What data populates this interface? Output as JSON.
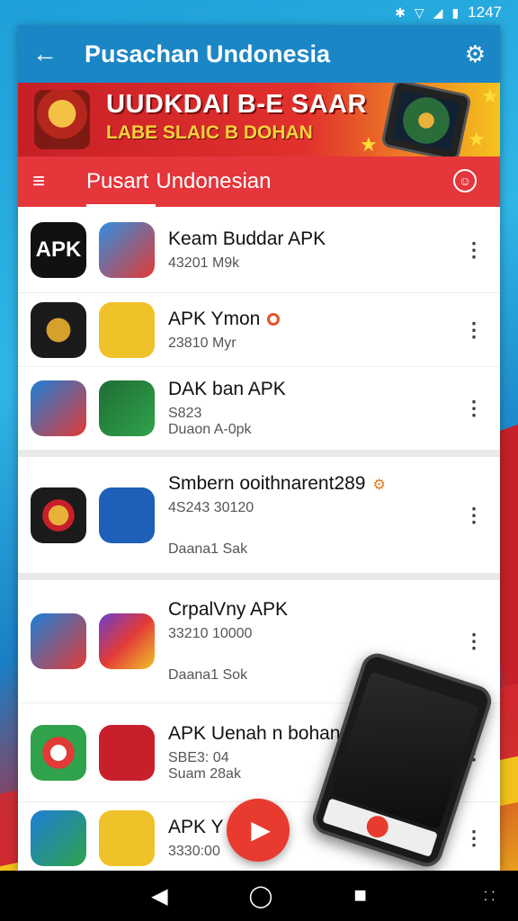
{
  "status_bar": {
    "time": "1247"
  },
  "app_bar": {
    "title": "Pusachan Undonesia"
  },
  "banner": {
    "line1": "UUDKDAI B-E SAAR",
    "line2": "LABE SLAIC B DOHAN"
  },
  "tabs": {
    "active": "Pusart",
    "other": "Undonesian"
  },
  "icons": {
    "back": "back-arrow-icon",
    "settings": "gear-icon",
    "menu": "hamburger-menu-icon",
    "account": "account-icon",
    "more": "more-vertical-icon",
    "play": "play-icon"
  },
  "colors": {
    "app_bar": "#1b86c6",
    "tab_bar": "#e4363b",
    "fab": "#e83a2e"
  },
  "apps": [
    {
      "icon1_text": "APK",
      "name": "Keam Buddar APK",
      "line2": "43201 M9k",
      "line3": ""
    },
    {
      "icon1_text": "",
      "name": "APK Ymon",
      "line2": "23810 Mуr",
      "line3": ""
    },
    {
      "icon1_text": "",
      "name": "DAK ban APK",
      "line2": "S823",
      "line3": "Duaon A-0pk"
    },
    {
      "icon1_text": "",
      "name": "Smbern ooithnarent289",
      "line2": "4S243 30120",
      "line3": "Daana1 Sak"
    },
    {
      "icon1_text": "",
      "name": "CrpalVny APK",
      "line2": "33210 10000",
      "line3": "Daana1 Sok"
    },
    {
      "icon1_text": "",
      "name": "APK Uenah n bohan",
      "line2": "SBE3: 04",
      "line3": "Suam 28ak"
    },
    {
      "icon1_text": "",
      "name": "APK Y",
      "line2": "3330:00",
      "line3": ""
    }
  ],
  "more_glyph": "⋮",
  "nav": {
    "back": "◀",
    "home": "◯",
    "recents": "■",
    "extra": "⸬"
  }
}
